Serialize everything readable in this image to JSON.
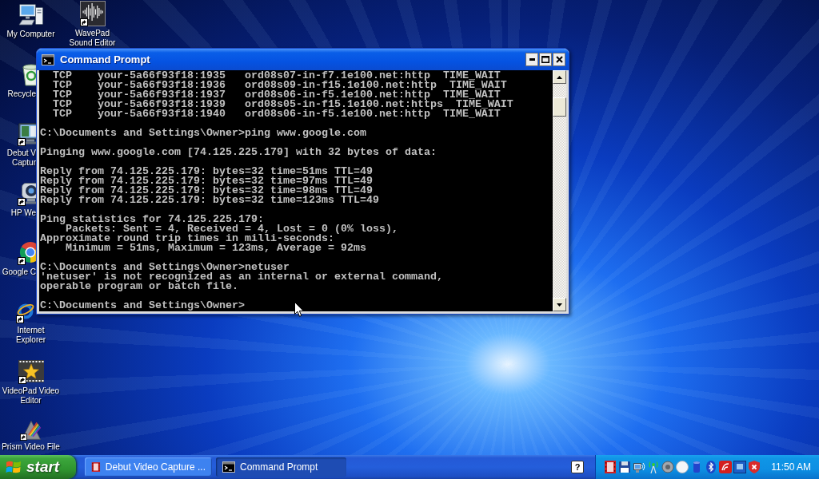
{
  "desktop": {
    "icon_columns": [
      {
        "icons": [
          {
            "label_lines": [
              "My Computer"
            ],
            "shortcut": false
          },
          {
            "label_lines": [
              "Recycle"
            ],
            "shortcut": false
          },
          {
            "label_lines": [
              "Debut V",
              "Captur"
            ],
            "shortcut": true
          },
          {
            "label_lines": [
              "HP We"
            ],
            "shortcut": true
          },
          {
            "label_lines": [
              "Google C"
            ],
            "shortcut": true
          },
          {
            "label_lines": [
              "Internet",
              "Explorer"
            ],
            "shortcut": true
          },
          {
            "label_lines": [
              "VideoPad Video",
              "Editor"
            ],
            "shortcut": true
          },
          {
            "label_lines": [
              "Prism Video File"
            ],
            "shortcut": true
          }
        ]
      },
      {
        "icons": [
          {
            "label_lines": [
              "WavePad",
              "Sound Editor"
            ],
            "shortcut": true
          }
        ]
      }
    ]
  },
  "window": {
    "title": "Command Prompt",
    "console": {
      "blocks": [
        [
          "  TCP    your-5a66f93f18:1935   ord08s07-in-f7.1e100.net:http  TIME_WAIT",
          "  TCP    your-5a66f93f18:1936   ord08s09-in-f15.1e100.net:http  TIME_WAIT",
          "  TCP    your-5a66f93f18:1937   ord08s06-in-f5.1e100.net:http  TIME_WAIT",
          "  TCP    your-5a66f93f18:1939   ord08s05-in-f15.1e100.net:https  TIME_WAIT",
          "  TCP    your-5a66f93f18:1940   ord08s06-in-f5.1e100.net:http  TIME_WAIT"
        ],
        [
          "C:\\Documents and Settings\\Owner>ping www.google.com"
        ],
        [
          "Pinging www.google.com [74.125.225.179] with 32 bytes of data:"
        ],
        [
          "Reply from 74.125.225.179: bytes=32 time=51ms TTL=49",
          "Reply from 74.125.225.179: bytes=32 time=97ms TTL=49",
          "Reply from 74.125.225.179: bytes=32 time=98ms TTL=49",
          "Reply from 74.125.225.179: bytes=32 time=123ms TTL=49"
        ],
        [
          "Ping statistics for 74.125.225.179:",
          "    Packets: Sent = 4, Received = 4, Lost = 0 (0% loss),",
          "Approximate round trip times in milli-seconds:",
          "    Minimum = 51ms, Maximum = 123ms, Average = 92ms"
        ],
        [
          "C:\\Documents and Settings\\Owner>netuser",
          "'netuser' is not recognized as an internal or external command,",
          "operable program or batch file."
        ],
        [
          "C:\\Documents and Settings\\Owner>"
        ]
      ]
    }
  },
  "taskbar": {
    "start": "start",
    "tasks": [
      {
        "label": "Debut Video Capture ...",
        "selected": false
      },
      {
        "label": "Command Prompt",
        "selected": true
      }
    ],
    "help_button": "?",
    "clock": "11:50 AM"
  }
}
